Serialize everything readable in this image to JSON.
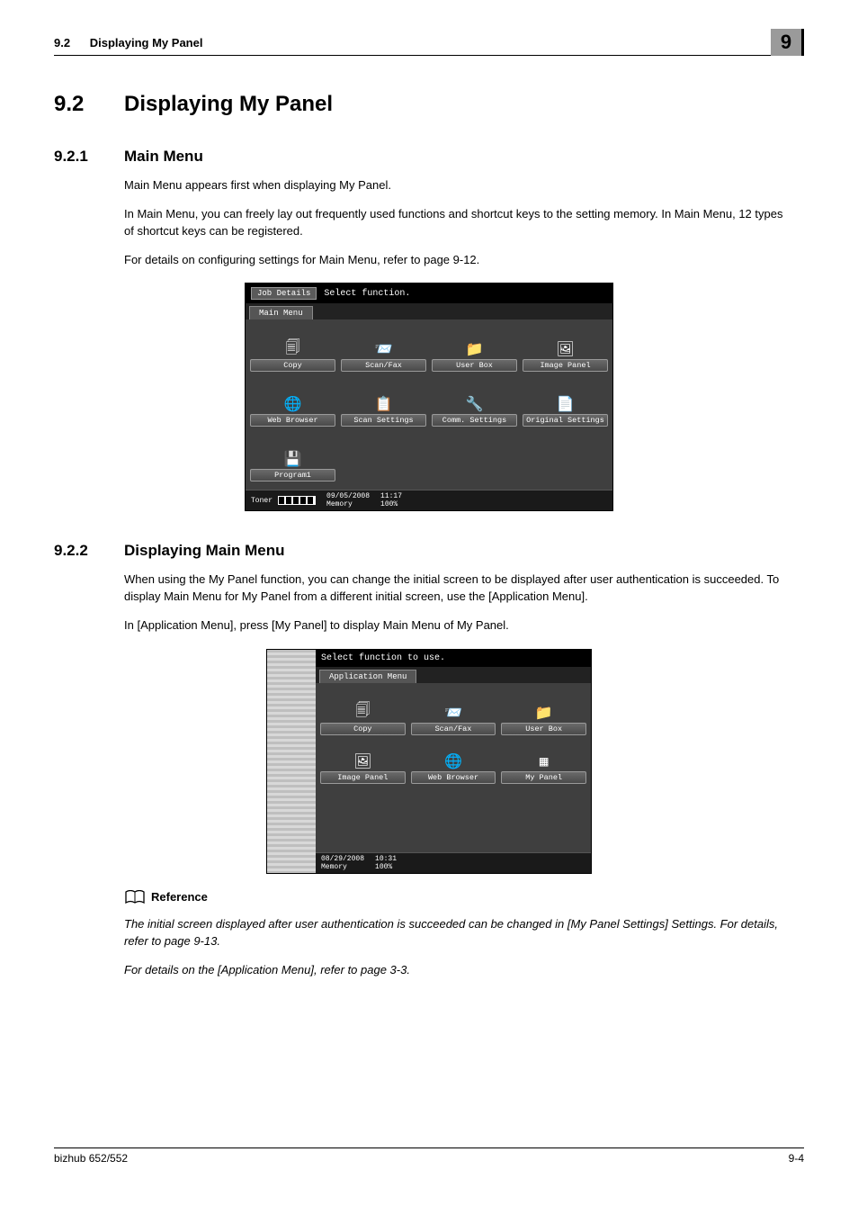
{
  "header": {
    "left_num": "9.2",
    "left_title": "Displaying My Panel",
    "chapter": "9"
  },
  "section": {
    "num": "9.2",
    "title": "Displaying My Panel"
  },
  "sub1": {
    "num": "9.2.1",
    "title": "Main Menu",
    "p1": "Main Menu appears first when displaying My Panel.",
    "p2": "In Main Menu, you can freely lay out frequently used functions and shortcut keys to the setting memory. In Main Menu, 12 types of shortcut keys can be registered.",
    "p3": "For details on configuring settings for Main Menu, refer to page 9-12."
  },
  "screenshot1": {
    "job_details": "Job Details",
    "instruction": "Select function.",
    "tab": "Main Menu",
    "items": [
      {
        "label": "Copy",
        "icon": "copy-icon"
      },
      {
        "label": "Scan/Fax",
        "icon": "scanfax-icon"
      },
      {
        "label": "User Box",
        "icon": "userbox-icon"
      },
      {
        "label": "Image Panel",
        "icon": "imagepanel-icon"
      },
      {
        "label": "Web Browser",
        "icon": "webbrowser-icon"
      },
      {
        "label": "Scan Settings",
        "icon": "scansettings-icon"
      },
      {
        "label": "Comm. Settings",
        "icon": "commsettings-icon"
      },
      {
        "label": "Original Settings",
        "icon": "originalsettings-icon"
      },
      {
        "label": "Program1",
        "icon": "program-icon"
      }
    ],
    "status": {
      "toner": "Toner",
      "date": "09/05/2008",
      "time": "11:17",
      "memory_label": "Memory",
      "memory_val": "100%"
    }
  },
  "sub2": {
    "num": "9.2.2",
    "title": "Displaying Main Menu",
    "p1": "When using the My Panel function, you can change the initial screen to be displayed after user authentication is succeeded. To display Main Menu for My Panel from a different initial screen, use the [Application Menu].",
    "p2": "In [Application Menu], press [My Panel] to display Main Menu of My Panel."
  },
  "screenshot2": {
    "instruction": "Select function to use.",
    "tab": "Application Menu",
    "items": [
      {
        "label": "Copy",
        "icon": "copy-icon"
      },
      {
        "label": "Scan/Fax",
        "icon": "scanfax-icon"
      },
      {
        "label": "User Box",
        "icon": "userbox-icon"
      },
      {
        "label": "Image Panel",
        "icon": "imagepanel-icon"
      },
      {
        "label": "Web Browser",
        "icon": "webbrowser-icon"
      },
      {
        "label": "My Panel",
        "icon": "mypanel-icon"
      }
    ],
    "status": {
      "date": "08/29/2008",
      "time": "10:31",
      "memory_label": "Memory",
      "memory_val": "100%"
    }
  },
  "reference": {
    "label": "Reference",
    "p1": "The initial screen displayed after user authentication is succeeded can be changed in [My Panel Settings] Settings. For details, refer to page 9-13.",
    "p2": "For details on the [Application Menu], refer to page 3-3."
  },
  "footer": {
    "left": "bizhub 652/552",
    "right": "9-4"
  }
}
